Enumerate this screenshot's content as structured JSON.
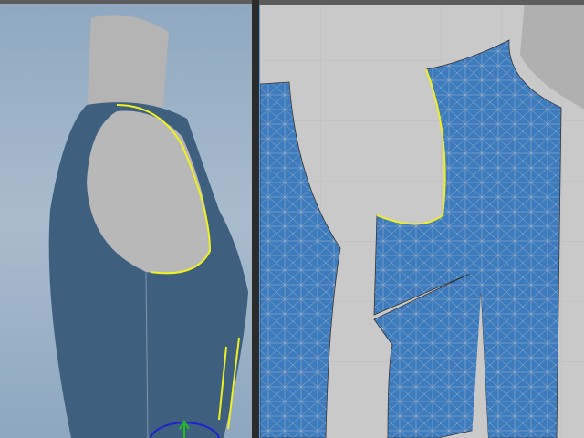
{
  "colors": {
    "viewport_3d_bg": "#9fb4c8",
    "viewport_2d_bg": "#c9c9c9",
    "fabric": "#3d7bbf",
    "mesh_line": "#a9b8c8",
    "selected_line": "#f0f020",
    "avatar": "#b5b5b5"
  },
  "icons": [
    "gizmo-icon",
    "splitter-handle-icon"
  ]
}
